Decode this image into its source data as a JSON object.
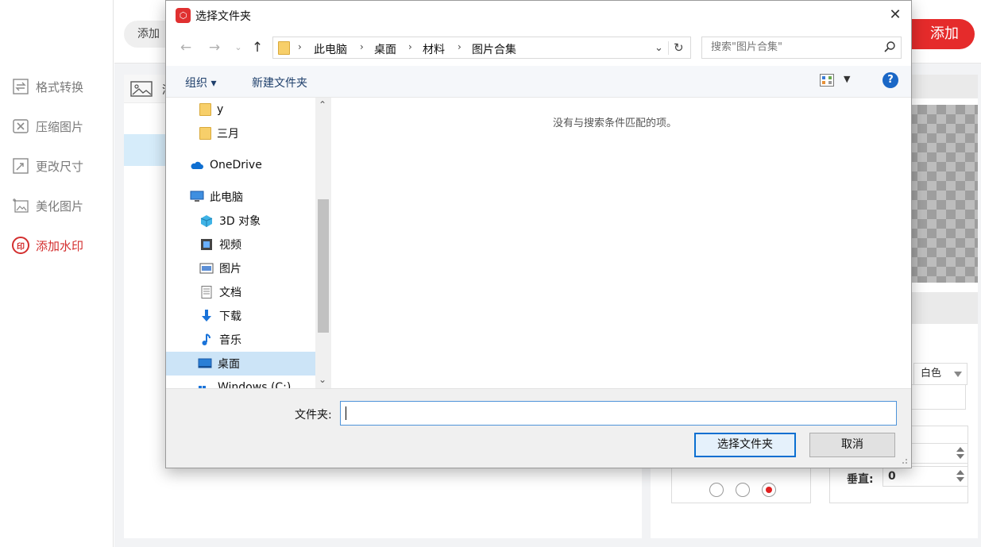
{
  "app": {
    "sidebar": [
      {
        "label": "格式转换",
        "icon": "format-convert-icon"
      },
      {
        "label": "压缩图片",
        "icon": "compress-icon"
      },
      {
        "label": "更改尺寸",
        "icon": "resize-icon"
      },
      {
        "label": "美化图片",
        "icon": "beautify-icon"
      },
      {
        "label": "添加水印",
        "icon": "watermark-icon",
        "badge": "印",
        "active": true
      }
    ],
    "topbar": {
      "add_file_label": "添加",
      "add_watermark_label": "添加"
    },
    "list_header_text": "添",
    "settings": {
      "color_value": "白色",
      "vertical_label": "垂直:",
      "vertical_value": "0"
    },
    "colors": {
      "accent": "#e52b2b",
      "active_text": "#d32f2f",
      "selection": "#cce4f7"
    }
  },
  "dialog": {
    "title": "选择文件夹",
    "close_glyph": "✕",
    "breadcrumbs": [
      "此电脑",
      "桌面",
      "材料",
      "图片合集"
    ],
    "search_placeholder": "搜索\"图片合集\"",
    "toolbar": {
      "organize": "组织 ▾",
      "new_folder": "新建文件夹"
    },
    "tree": [
      {
        "label": "y",
        "icon": "folder-icon"
      },
      {
        "label": "三月",
        "icon": "folder-icon"
      },
      {
        "label": "OneDrive",
        "icon": "cloud-icon"
      },
      {
        "label": "此电脑",
        "icon": "computer-icon"
      },
      {
        "label": "3D 对象",
        "icon": "cube-icon"
      },
      {
        "label": "视频",
        "icon": "video-icon"
      },
      {
        "label": "图片",
        "icon": "picture-icon"
      },
      {
        "label": "文档",
        "icon": "document-icon"
      },
      {
        "label": "下载",
        "icon": "download-icon"
      },
      {
        "label": "音乐",
        "icon": "music-icon"
      },
      {
        "label": "桌面",
        "icon": "desktop-icon",
        "selected": true
      },
      {
        "label": "Windows (C:)",
        "icon": "drive-icon"
      }
    ],
    "empty_message": "没有与搜索条件匹配的项。",
    "folder_label": "文件夹:",
    "folder_value": "",
    "buttons": {
      "select": "选择文件夹",
      "cancel": "取消"
    }
  }
}
